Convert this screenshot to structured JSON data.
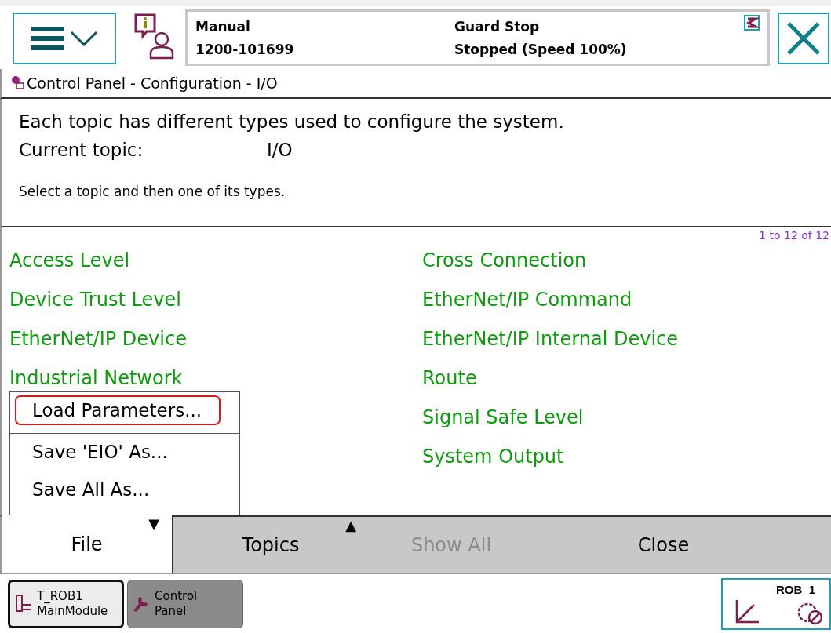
{
  "status": {
    "mode": "Manual",
    "controller": "1200-101699",
    "safety": "Guard Stop",
    "state": "Stopped (Speed 100%)"
  },
  "breadcrumb": "Control Panel - Configuration - I/O",
  "description": {
    "intro": "Each topic has different types used to configure the system.",
    "topic_label": "Current topic:",
    "topic_value": "I/O",
    "hint": "Select a topic and then one of its types."
  },
  "list": {
    "counter": "1 to 12 of 12",
    "left": [
      "Access Level",
      "Device Trust Level",
      "EtherNet/IP Device",
      "Industrial Network"
    ],
    "right": [
      "Cross Connection",
      "EtherNet/IP Command",
      "EtherNet/IP Internal Device",
      "Route",
      "Signal Safe Level",
      "System Output"
    ]
  },
  "file_menu": [
    {
      "label": "Load Parameters...",
      "selected": true
    },
    {
      "label": "Save 'EIO' As...",
      "selected": false
    },
    {
      "label": "Save All As...",
      "selected": false
    }
  ],
  "commands": [
    {
      "label": "File",
      "caret": "▼",
      "selected": true,
      "disabled": false
    },
    {
      "label": "Topics",
      "caret": "▲",
      "selected": false,
      "disabled": false
    },
    {
      "label": "Show All",
      "selected": false,
      "disabled": true
    },
    {
      "label": "Close",
      "selected": false,
      "disabled": false
    }
  ],
  "taskbar": [
    {
      "lines": [
        "T_ROB1",
        "MainModule"
      ],
      "selected": true,
      "kind": "module"
    },
    {
      "lines": [
        "Control",
        "Panel"
      ],
      "selected": false,
      "kind": "tool"
    }
  ],
  "mechanical_unit": "ROB_1"
}
